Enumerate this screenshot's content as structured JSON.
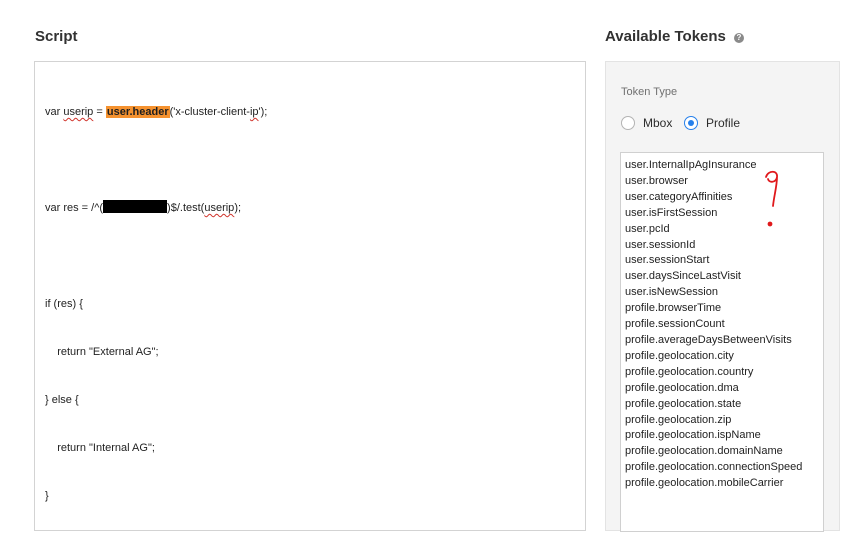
{
  "script": {
    "title": "Script",
    "code": {
      "l1_a": "var ",
      "l1_userip": "userip",
      "l1_b": " = ",
      "l1_hl": "user.header",
      "l1_c": "('x-cluster-client-",
      "l1_ip": "ip",
      "l1_d": "');",
      "l2_a": "var res = /^(",
      "l2_b": ")$/.test(",
      "l2_userip": "userip",
      "l2_c": ");",
      "l3": "if (res) {",
      "l4": "    return \"External AG\";",
      "l5": "} else {",
      "l6": "    return \"Internal AG\";",
      "l7": "}"
    }
  },
  "tokens": {
    "title": "Available Tokens",
    "help_icon": "?",
    "token_type_label": "Token Type",
    "options": [
      {
        "label": "Mbox",
        "selected": false
      },
      {
        "label": "Profile",
        "selected": true
      }
    ],
    "items": [
      "user.InternalIpAgInsurance",
      "user.browser",
      "user.categoryAffinities",
      "user.isFirstSession",
      "user.pcId",
      "user.sessionId",
      "user.sessionStart",
      "user.daysSinceLastVisit",
      "user.isNewSession",
      "profile.browserTime",
      "profile.sessionCount",
      "profile.averageDaysBetweenVisits",
      "profile.geolocation.city",
      "profile.geolocation.country",
      "profile.geolocation.dma",
      "profile.geolocation.state",
      "profile.geolocation.zip",
      "profile.geolocation.ispName",
      "profile.geolocation.domainName",
      "profile.geolocation.connectionSpeed",
      "profile.geolocation.mobileCarrier"
    ]
  },
  "colors": {
    "highlight": "#f5922f",
    "radio_selected": "#2680eb",
    "annotation": "#e0191c"
  }
}
